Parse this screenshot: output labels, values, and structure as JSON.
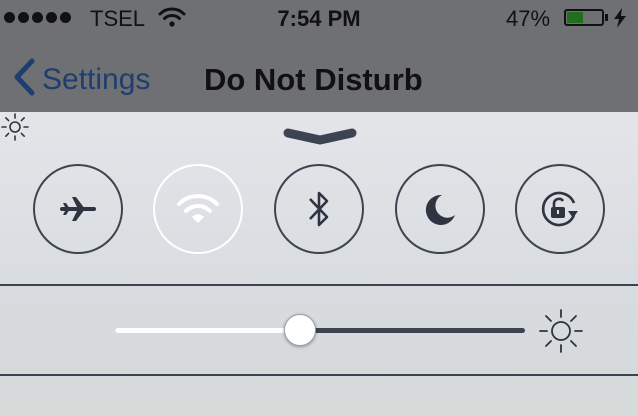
{
  "status_bar": {
    "carrier": "TSEL",
    "signal_bars": 5,
    "time": "7:54 PM",
    "battery_percent": "47%",
    "battery_level": 0.47,
    "icons": [
      "signal-dots",
      "wifi-icon",
      "battery-icon",
      "charging-bolt-icon"
    ]
  },
  "nav": {
    "back_label": "Settings",
    "title": "Do Not Disturb"
  },
  "control_center": {
    "toggles": [
      {
        "name": "airplane-mode",
        "icon": "airplane-icon",
        "active": false
      },
      {
        "name": "wifi",
        "icon": "wifi-icon",
        "active": true
      },
      {
        "name": "bluetooth",
        "icon": "bluetooth-icon",
        "active": false
      },
      {
        "name": "do-not-disturb",
        "icon": "moon-icon",
        "active": false
      },
      {
        "name": "rotation-lock",
        "icon": "rotation-lock-icon",
        "active": false
      }
    ],
    "brightness": 0.45,
    "colors": {
      "bar": "#6e7074",
      "accent": "#1d3e6e",
      "ring": "#3d4350",
      "active_ring": "#ffffff"
    }
  }
}
